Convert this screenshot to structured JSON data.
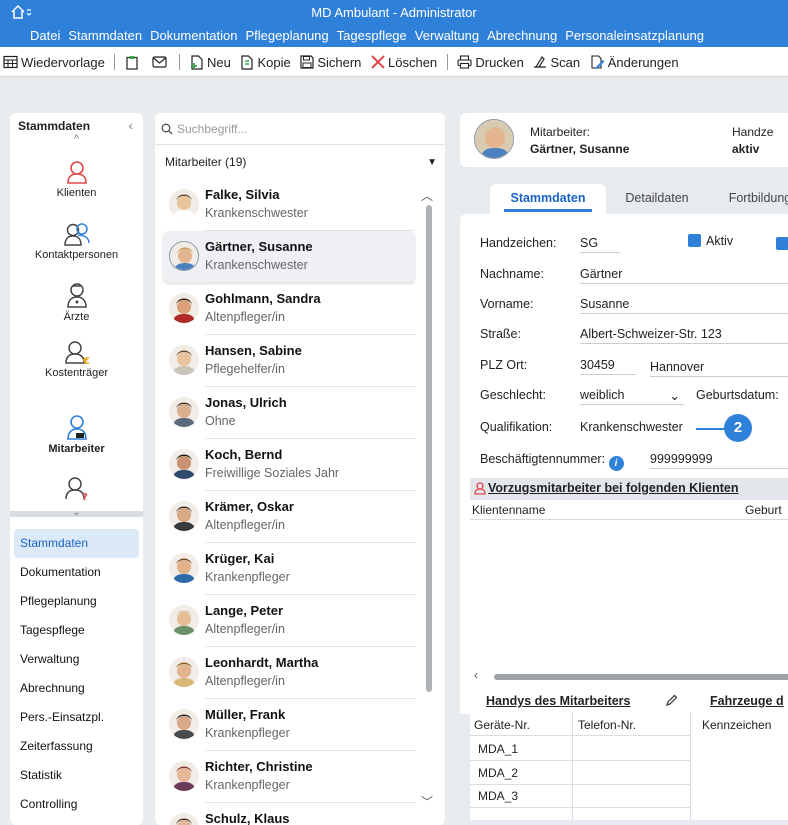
{
  "window": {
    "title": "MD Ambulant - Administrator"
  },
  "menu": [
    "Datei",
    "Stammdaten",
    "Dokumentation",
    "Pflegeplanung",
    "Tagespflege",
    "Verwaltung",
    "Abrechnung",
    "Personaleinsatzplanung"
  ],
  "toolbar": {
    "wiedervorlage": "Wiedervorlage",
    "neu": "Neu",
    "kopie": "Kopie",
    "sichern": "Sichern",
    "loeschen": "Löschen",
    "drucken": "Drucken",
    "scan": "Scan",
    "aenderungen": "Änderungen"
  },
  "leftnav": {
    "header": "Stammdaten",
    "categories": [
      {
        "label": "Klienten",
        "icon": "client-icon",
        "color": "#e04848"
      },
      {
        "label": "Kontaktpersonen",
        "icon": "contacts-icon",
        "color": "#2f80d8"
      },
      {
        "label": "Ärzte",
        "icon": "doctor-icon",
        "color": "#444444"
      },
      {
        "label": "Kostenträger",
        "icon": "payer-icon",
        "color": "#444444"
      },
      {
        "label": "Mitarbeiter",
        "icon": "employee-icon",
        "color": "#2f80d8"
      }
    ],
    "modules": [
      "Stammdaten",
      "Dokumentation",
      "Pflegeplanung",
      "Tagespflege",
      "Verwaltung",
      "Abrechnung",
      "Pers.-Einsatzpl.",
      "Zeiterfassung",
      "Statistik",
      "Controlling"
    ]
  },
  "list": {
    "search_placeholder": "Suchbegriff...",
    "group": "Mitarbeiter (19)",
    "employees": [
      {
        "name": "Falke, Silvia",
        "role": "Krankenschwester"
      },
      {
        "name": "Gärtner, Susanne",
        "role": "Krankenschwester"
      },
      {
        "name": "Gohlmann, Sandra",
        "role": "Altenpfleger/in"
      },
      {
        "name": "Hansen, Sabine",
        "role": "Pflegehelfer/in"
      },
      {
        "name": "Jonas, Ulrich",
        "role": "Ohne"
      },
      {
        "name": "Koch, Bernd",
        "role": "Freiwillige Soziales Jahr"
      },
      {
        "name": "Krämer, Oskar",
        "role": "Altenpfleger/in"
      },
      {
        "name": "Krüger, Kai",
        "role": "Krankenpfleger"
      },
      {
        "name": "Lange, Peter",
        "role": "Altenpfleger/in"
      },
      {
        "name": "Leonhardt, Martha",
        "role": "Altenpfleger/in"
      },
      {
        "name": "Müller, Frank",
        "role": "Krankenpfleger"
      },
      {
        "name": "Richter, Christine",
        "role": "Krankenpfleger"
      },
      {
        "name": "Schulz, Klaus",
        "role": ""
      }
    ]
  },
  "header": {
    "k1": "Mitarbeiter:",
    "v1": "Gärtner, Susanne",
    "k2": "Handze",
    "v2": "aktiv"
  },
  "tabs": [
    "Stammdaten",
    "Detaildaten",
    "Fortbildung"
  ],
  "form": {
    "handzeichen_label": "Handzeichen:",
    "handzeichen": "SG",
    "aktiv_label": "Aktiv",
    "nachname_label": "Nachname:",
    "nachname": "Gärtner",
    "vorname_label": "Vorname:",
    "vorname": "Susanne",
    "strasse_label": "Straße:",
    "strasse": "Albert-Schweizer-Str. 123",
    "plzort_label": "PLZ Ort:",
    "plz": "30459",
    "ort": "Hannover",
    "geschlecht_label": "Geschlecht:",
    "geschlecht": "weiblich",
    "geburtsdatum_label": "Geburtsdatum:",
    "qualifikation_label": "Qualifikation:",
    "qualifikation": "Krankenschwester",
    "beschaeftigten_label": "Beschäftigtennummer:",
    "beschaeftigten": "999999999",
    "marker": "2"
  },
  "clients": {
    "title": "Vorzugsmitarbeiter bei folgenden Klienten",
    "col1": "Klientenname",
    "col2": "Geburt"
  },
  "handys": {
    "title": "Handys des Mitarbeiters",
    "col1": "Geräte-Nr.",
    "col2": "Telefon-Nr.",
    "rows": [
      "MDA_1",
      "MDA_2",
      "MDA_3"
    ]
  },
  "fahrzeuge": {
    "title": "Fahrzeuge d",
    "col1": "Kennzeichen"
  }
}
